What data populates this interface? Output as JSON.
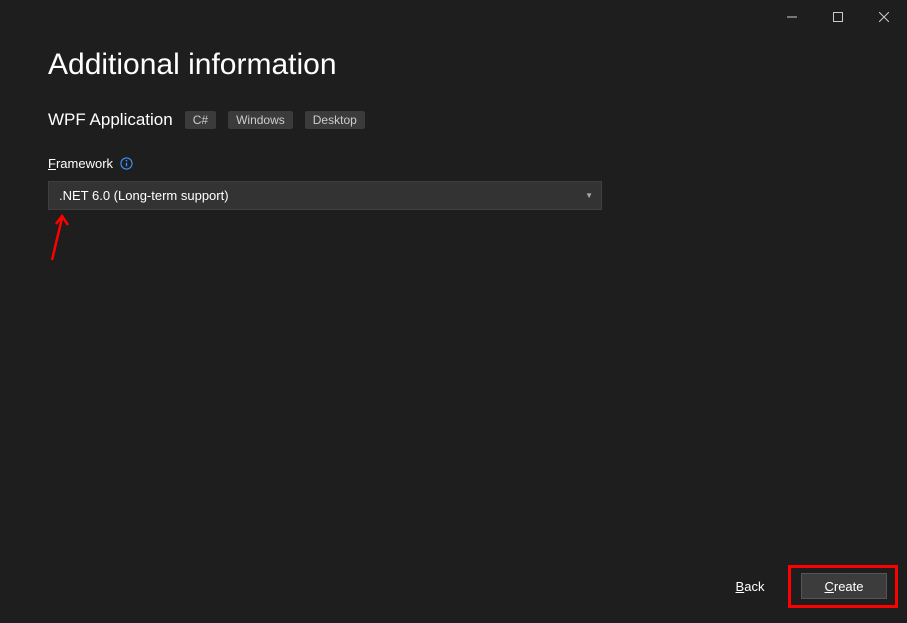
{
  "window": {
    "title": "Additional information"
  },
  "project": {
    "name": "WPF Application",
    "tags": [
      "C#",
      "Windows",
      "Desktop"
    ]
  },
  "framework": {
    "label_prefix": "F",
    "label_rest": "ramework",
    "selected": ".NET 6.0 (Long-term support)"
  },
  "buttons": {
    "back_prefix": "B",
    "back_rest": "ack",
    "create_prefix": "C",
    "create_rest": "reate"
  }
}
